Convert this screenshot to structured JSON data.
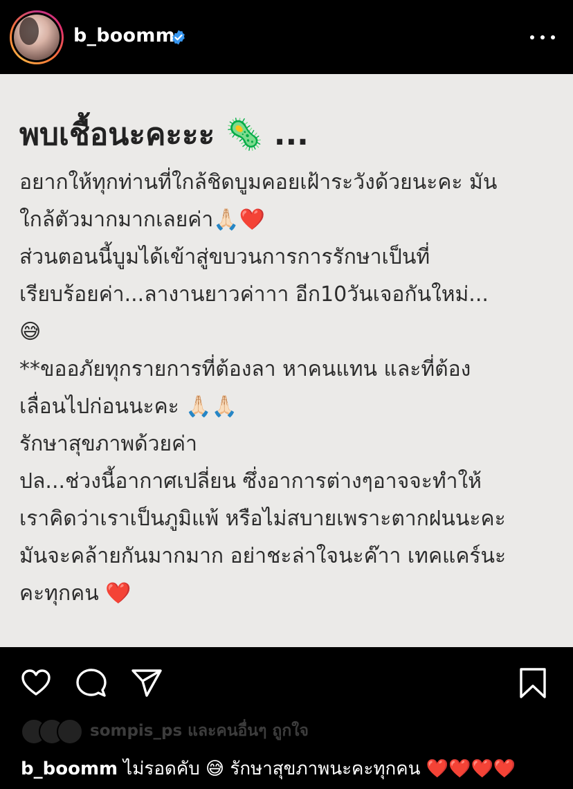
{
  "header": {
    "username": "b_boomm",
    "verified_color": "#3897f0",
    "more_icon": "more-horizontal-icon"
  },
  "post": {
    "background": "#ebeae8",
    "title": "พบเชื้อนะคะะะ 🦠 ...",
    "lines": [
      "อยากให้ทุกท่านที่ใกล้ชิดบูมคอยเฝ้าระวังด้วยนะคะ มัน",
      "ใกล้ตัวมากมากเลยค่า🙏🏻❤️",
      "ส่วนตอนนี้บูมได้เข้าสู่ขบวนการการรักษาเป็นที่",
      "เรียบร้อยค่า...ลางานยาวค่าาา อีก10วันเจอกันใหม่...",
      "😅",
      "**ขออภัยทุกรายการที่ต้องลา หาคนแทน และที่ต้อง",
      "เลื่อนไปก่อนนะคะ 🙏🏻🙏🏻",
      "รักษาสุขภาพด้วยค่า",
      "ปล...ช่วงนี้อากาศเปลี่ยน ซึ่งอาการต่างๆอาจจะทำให้",
      "เราคิดว่าเราเป็นภูมิแพ้ หรือไม่สบายเพราะตากฝนนะคะ",
      "มันจะคล้ายกันมากมาก อย่าชะล่าใจนะค๊าา เทคแคร์นะ",
      "คะทุกคน ❤️"
    ]
  },
  "actions": {
    "like_icon": "heart-icon",
    "comment_icon": "comment-icon",
    "share_icon": "send-icon",
    "save_icon": "bookmark-icon"
  },
  "likes": {
    "text": "sompis_ps และคนอื่นๆ ถูกใจ"
  },
  "caption": {
    "username": "b_boomm",
    "text": "ไม่รอดคับ 😅 รักษาสุขภาพนะคะทุกคน ❤️❤️❤️❤️"
  }
}
